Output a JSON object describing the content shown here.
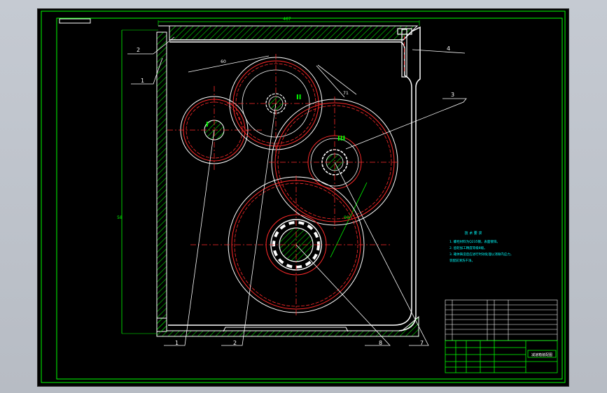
{
  "drawing": {
    "dim_top": "467",
    "dim_left": "58",
    "dim_a": "60",
    "dim_b": "71",
    "dim_c": "90",
    "shaft_labels": [
      "I",
      "II",
      "III"
    ],
    "callouts": [
      "1",
      "2",
      "3",
      "4",
      "1",
      "2",
      "8",
      "7"
    ]
  },
  "notes": {
    "title": "技 术 要 求",
    "lines": [
      "1. 螺栓材料为Q235钢，表面镀锌。",
      "2. 齿轮加工精度等级8级。",
      "3. 箱体铸造后应进行时效处理以消除内应力，",
      "   装配前清洗干净。"
    ]
  },
  "title_block": {
    "drawing_name": "减速箱装配图"
  },
  "colors": {
    "frame": "#00ff00",
    "hatch": "#00d000",
    "body": "#ffffff",
    "gear": "#ff2a2a",
    "note": "#00ffff"
  }
}
